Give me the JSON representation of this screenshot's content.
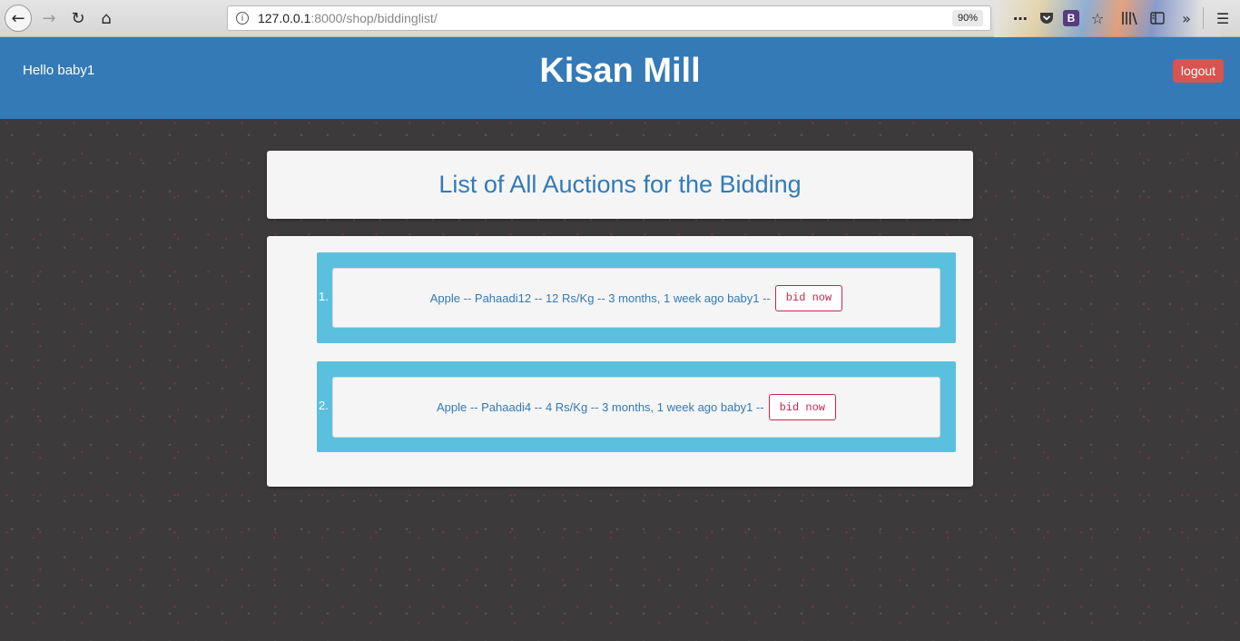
{
  "browser": {
    "url_host": "127.0.0.1",
    "url_path": ":8000/shop/biddinglist/",
    "zoom": "90%"
  },
  "header": {
    "greeting": "Hello baby1",
    "title": "Kisan Mill",
    "logout_label": "logout"
  },
  "page": {
    "heading": "List of All Auctions for the Bidding"
  },
  "auctions": [
    {
      "number": "1.",
      "text": "Apple -- Pahaadi12 -- 12 Rs/Kg -- 3 months, 1 week ago baby1 --",
      "bid_label": "bid now"
    },
    {
      "number": "2.",
      "text": "Apple -- Pahaadi4 -- 4 Rs/Kg -- 3 months, 1 week ago baby1 --",
      "bid_label": "bid now"
    }
  ],
  "colors": {
    "header_bg": "#337ab7",
    "logout_bg": "#d9534f",
    "item_bg": "#5bc0de",
    "bid_accent": "#c7254e"
  }
}
